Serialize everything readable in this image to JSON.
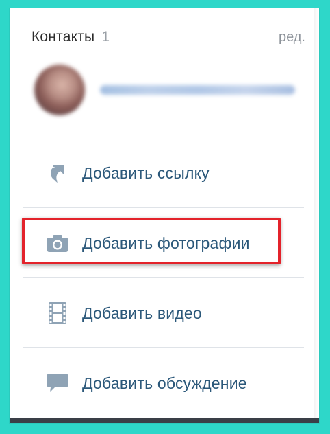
{
  "header": {
    "title": "Контакты",
    "count": "1",
    "edit_label": "ред."
  },
  "contact": {
    "name": ""
  },
  "actions": [
    {
      "label": "Добавить ссылку",
      "icon": "link-arrow-icon"
    },
    {
      "label": "Добавить фотографии",
      "icon": "camera-icon",
      "highlighted": true
    },
    {
      "label": "Добавить видео",
      "icon": "film-icon"
    },
    {
      "label": "Добавить обсуждение",
      "icon": "speech-bubble-icon"
    }
  ],
  "colors": {
    "background": "#2ed7c9",
    "link_text": "#2b587a",
    "icon_gray": "#8fa3b5",
    "highlight_red": "#e3232b"
  }
}
